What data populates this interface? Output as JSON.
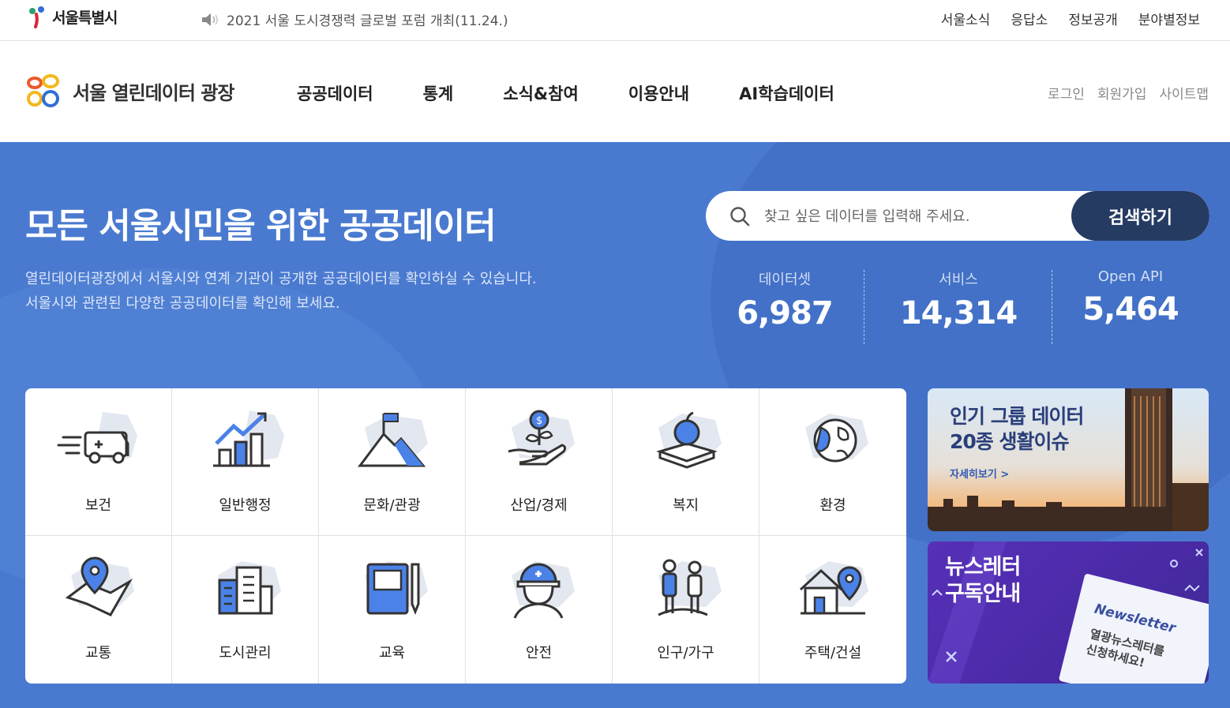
{
  "topbar": {
    "logo_text": "서울특별시",
    "notice": "2021 서울 도시경쟁력 글로벌 포럼 개최(11.24.)",
    "links": [
      "서울소식",
      "응답소",
      "정보공개",
      "분야별정보"
    ]
  },
  "header": {
    "brand": "서울 열린데이터 광장",
    "menu": [
      "공공데이터",
      "통계",
      "소식&참여",
      "이용안내",
      "AI학습데이터"
    ],
    "util": [
      "로그인",
      "회원가입",
      "사이트맵"
    ]
  },
  "hero": {
    "title": "모든 서울시민을 위한 공공데이터",
    "desc1": "열린데이터광장에서 서울시와 연계 기관이 공개한 공공데이터를 확인하실 수 있습니다.",
    "desc2": "서울시와 관련된 다양한 공공데이터를 확인해 보세요.",
    "search_placeholder": "찾고 싶은 데이터를 입력해 주세요.",
    "search_button": "검색하기",
    "stats": [
      {
        "label": "데이터셋",
        "value": "6,987"
      },
      {
        "label": "서비스",
        "value": "14,314"
      },
      {
        "label": "Open API",
        "value": "5,464"
      }
    ]
  },
  "categories": [
    "보건",
    "일반행정",
    "문화/관광",
    "산업/경제",
    "복지",
    "환경",
    "교통",
    "도시관리",
    "교육",
    "안전",
    "인구/가구",
    "주택/건설"
  ],
  "category_icons": [
    "ambulance-icon",
    "chart-icon",
    "mountain-flag-icon",
    "money-plant-icon",
    "apple-book-icon",
    "globe-leaf-icon",
    "map-pin-icon",
    "building-icon",
    "notebook-icon",
    "helmet-icon",
    "family-icon",
    "house-pin-icon"
  ],
  "banners": {
    "popular_title1": "인기 그룹 데이터",
    "popular_title2": "20종 생활이슈",
    "popular_more": "자세히보기 >",
    "newsletter_title1": "뉴스레터",
    "newsletter_title2": "구독안내",
    "newsletter_card_title": "Newsletter",
    "newsletter_card_sub1": "열광뉴스레터를",
    "newsletter_card_sub2": "신청하세요!"
  },
  "colors": {
    "hero_bg": "#4a7ad0",
    "search_button": "#263b62",
    "icon_blue": "#4b82e8"
  }
}
